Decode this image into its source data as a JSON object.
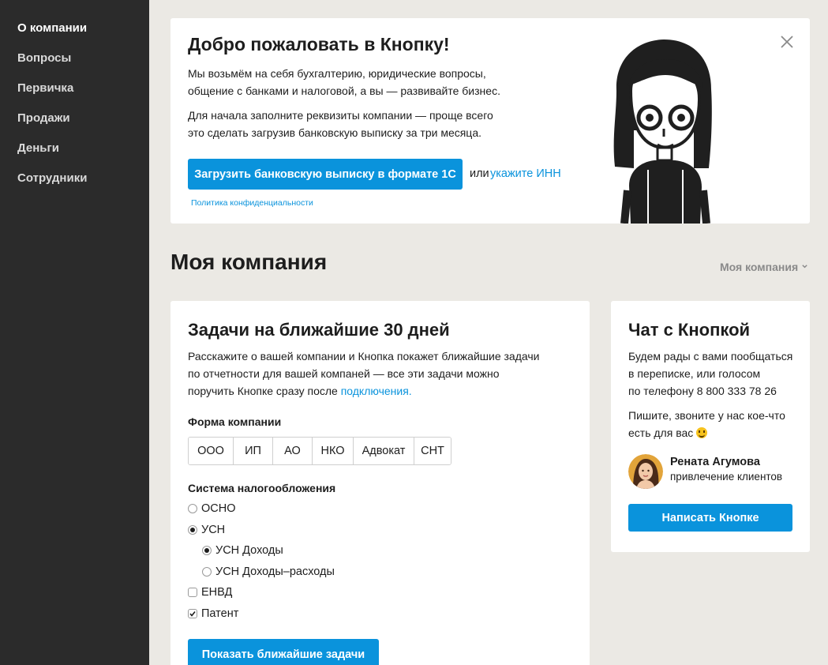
{
  "sidebar": {
    "items": [
      {
        "label": "О компании",
        "active": true
      },
      {
        "label": "Вопросы"
      },
      {
        "label": "Первичка"
      },
      {
        "label": "Продажи"
      },
      {
        "label": "Деньги"
      },
      {
        "label": "Сотрудники"
      }
    ]
  },
  "welcome": {
    "title": "Добро пожаловать в Кнопку!",
    "line1": "Мы возьмём на себя бухгалтерию, юридические вопросы,",
    "line2": "общение с банками и налоговой, а вы — развивайте бизнес.",
    "line3": "Для начала заполните реквизиты компании — проще всего",
    "line4": "это сделать загрузив банковскую выписку за три месяца.",
    "upload_button": "Загрузить банковскую выписку в формате 1С",
    "or_text": "или",
    "inn_link": "укажите ИНН",
    "privacy_link": "Политика конфиденциальности",
    "close_icon": "close-icon"
  },
  "page": {
    "title": "Моя компания",
    "company_dropdown": "Моя компания"
  },
  "tasks": {
    "title": "Задачи на ближайшие 30 дней",
    "desc1": "Расскажите о вашей компании и Кнопка покажет ближайшие задачи",
    "desc2": "по отчетности для вашей компаней — все эти задачи можно",
    "desc3": "поручить Кнопке сразу после",
    "desc_link": "подключения.",
    "company_form_label": "Форма компании",
    "company_forms": [
      "ООО",
      "ИП",
      "АО",
      "НКО",
      "Адвокат",
      "СНТ"
    ],
    "tax_label": "Система налогообложения",
    "tax_options": {
      "osno": "ОСНО",
      "usn": "УСН",
      "usn_income": "УСН Доходы",
      "usn_income_expense": "УСН Доходы–расходы",
      "envd": "ЕНВД",
      "patent": "Патент"
    },
    "selected": {
      "usn": true,
      "usn_income": true,
      "patent": true
    },
    "show_button": "Показать ближайшие задачи"
  },
  "chat": {
    "title": "Чат с Кнопкой",
    "p1_line1": "Будем рады с вами пообщаться",
    "p1_line2": "в переписке, или голосом",
    "p1_line3": "по телефону 8 800 333 78 26",
    "p2_line1": "Пишите, звоните у нас кое-что",
    "p2_line2": "есть для вас",
    "person_name": "Рената Агумова",
    "person_role": "привлечение клиентов",
    "write_button": "Написать Кнопке"
  },
  "colors": {
    "accent": "#0a93dc",
    "sidebar_bg": "#2b2b2b",
    "page_bg": "#ebe9e4"
  }
}
